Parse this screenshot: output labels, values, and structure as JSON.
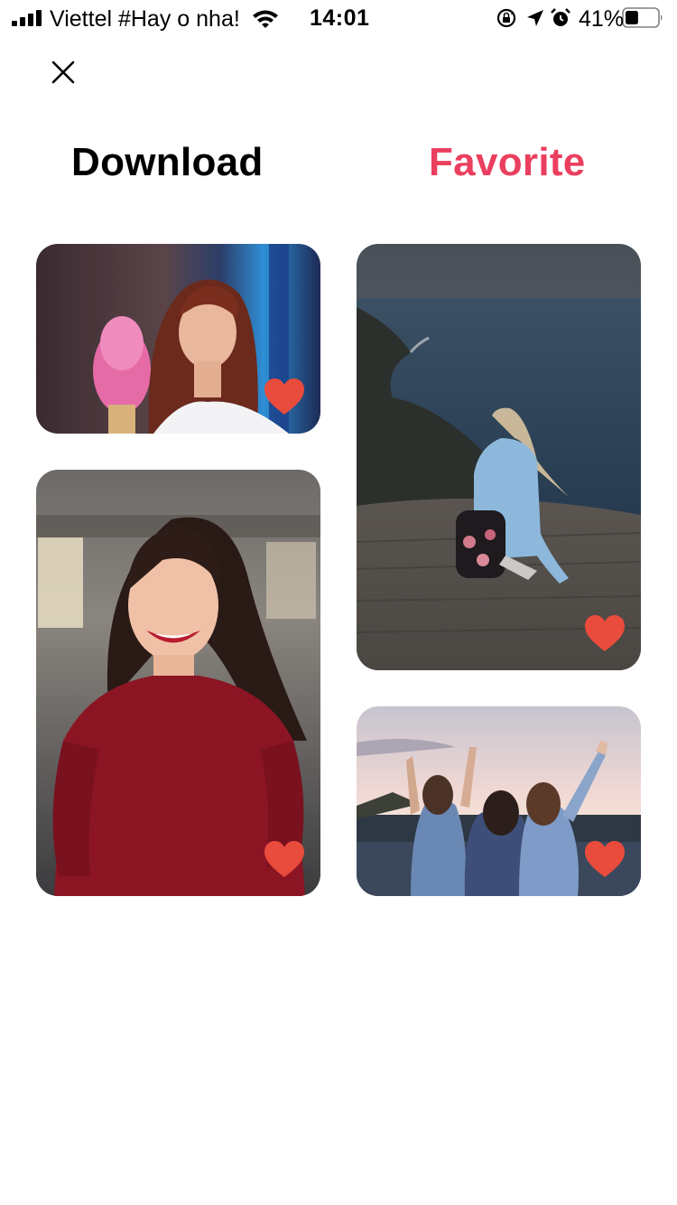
{
  "status_bar": {
    "carrier": "Viettel #Hay o nha!",
    "time": "14:01",
    "battery_percent": "41%",
    "battery_level": 0.41
  },
  "header": {
    "close_icon": "close-icon"
  },
  "tabs": [
    {
      "label": "Download",
      "color": "#000000",
      "active": false
    },
    {
      "label": "Favorite",
      "color": "#EB3F5F",
      "active": true
    }
  ],
  "gallery": {
    "heart_color": "#E94B3C",
    "items": [
      {
        "photo": "woman-red-hair-ice-cream",
        "favorited": true
      },
      {
        "photo": "smiling-woman-red-sweater",
        "favorited": true
      },
      {
        "photo": "girl-sitting-cliff-sea",
        "favorited": true
      },
      {
        "photo": "friends-sunset-arms-raised",
        "favorited": true
      }
    ]
  }
}
